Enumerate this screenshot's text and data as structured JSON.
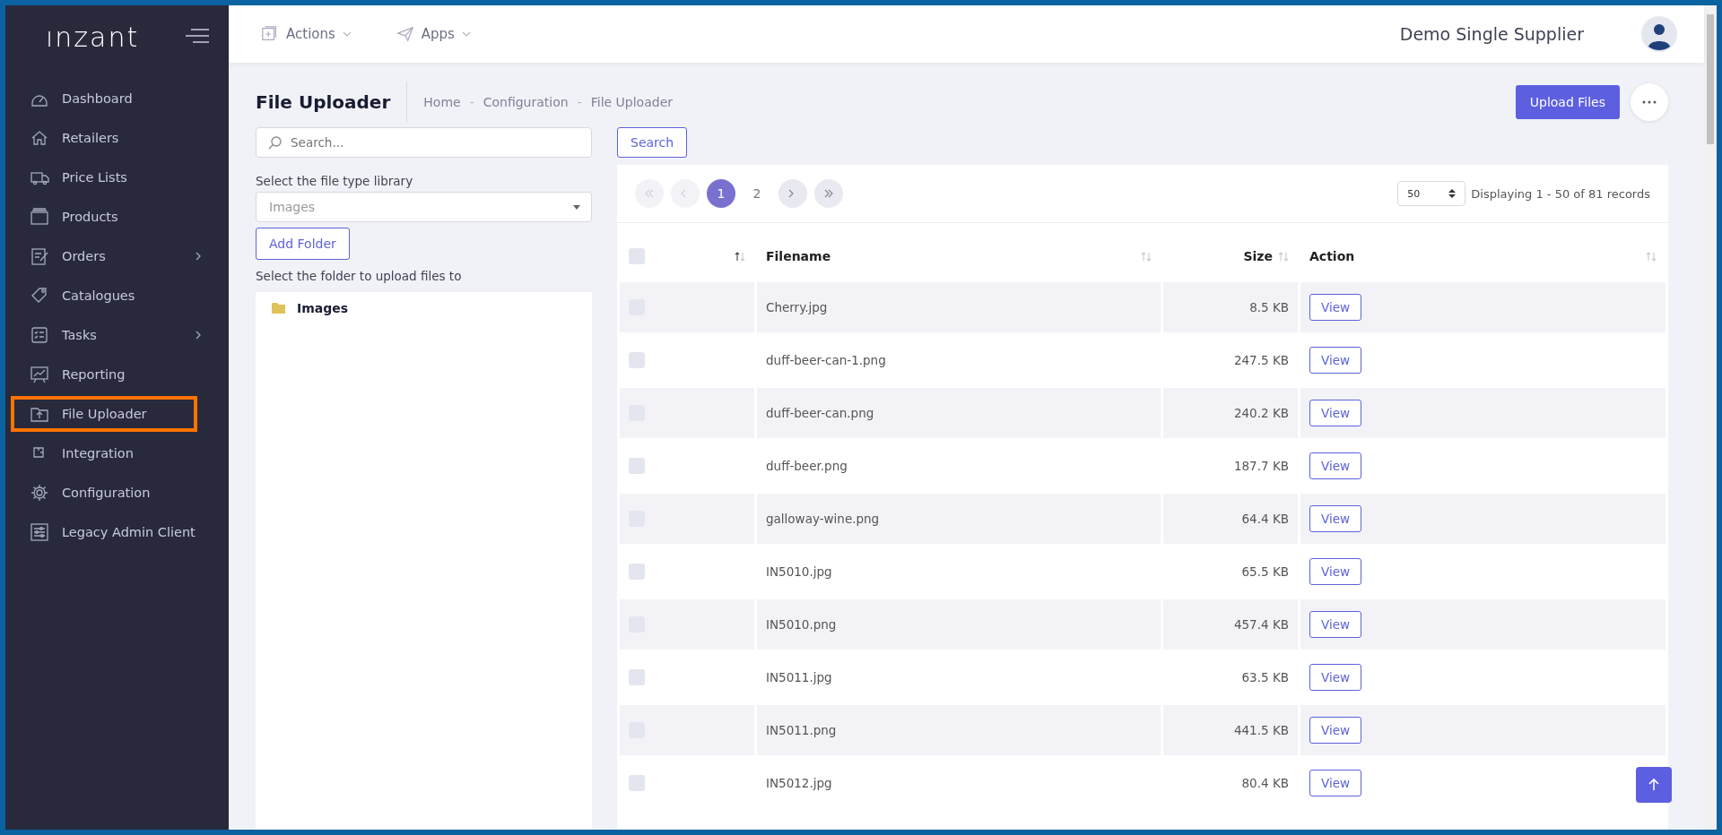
{
  "sidebar": {
    "logo": "ınzant",
    "items": [
      {
        "label": "Dashboard",
        "selected": false,
        "has_submenu": false
      },
      {
        "label": "Retailers",
        "selected": false,
        "has_submenu": false
      },
      {
        "label": "Price Lists",
        "selected": false,
        "has_submenu": false
      },
      {
        "label": "Products",
        "selected": false,
        "has_submenu": false
      },
      {
        "label": "Orders",
        "selected": false,
        "has_submenu": true
      },
      {
        "label": "Catalogues",
        "selected": false,
        "has_submenu": false
      },
      {
        "label": "Tasks",
        "selected": false,
        "has_submenu": true
      },
      {
        "label": "Reporting",
        "selected": false,
        "has_submenu": false
      },
      {
        "label": "File Uploader",
        "selected": true,
        "has_submenu": false
      },
      {
        "label": "Integration",
        "selected": false,
        "has_submenu": false
      },
      {
        "label": "Configuration",
        "selected": false,
        "has_submenu": false
      },
      {
        "label": "Legacy Admin Client",
        "selected": false,
        "has_submenu": false
      }
    ]
  },
  "topbar": {
    "menus": [
      {
        "label": "Actions"
      },
      {
        "label": "Apps"
      }
    ],
    "user": "Demo Single Supplier"
  },
  "page": {
    "title": "File Uploader",
    "breadcrumb": [
      {
        "kind": "link",
        "text": "Home"
      },
      {
        "kind": "separator",
        "text": "-"
      },
      {
        "kind": "link",
        "text": "Configuration"
      },
      {
        "kind": "separator",
        "text": "-"
      },
      {
        "kind": "link",
        "text": "File Uploader"
      }
    ],
    "upload_button": "Upload Files"
  },
  "left": {
    "search": {
      "placeholder": "Search..."
    },
    "library_label": "Select the file type library",
    "library_value": "Images",
    "add_folder": "Add Folder",
    "folder_label": "Select the folder to upload files to",
    "folders": [
      {
        "label": "Images"
      }
    ]
  },
  "search_button": "Search",
  "pagination": {
    "nav": [
      {
        "kind": "first",
        "disabled": true
      },
      {
        "kind": "prev",
        "disabled": true
      },
      {
        "kind": "pages"
      },
      {
        "kind": "next",
        "disabled": false
      },
      {
        "kind": "last",
        "disabled": false
      }
    ],
    "pages": [
      {
        "label": "1",
        "selected": true
      },
      {
        "label": "2",
        "selected": false
      }
    ],
    "page_size": "50",
    "summary": "Displaying 1 - 50 of 81 records"
  },
  "table": {
    "select_all_checked": false,
    "columns": [
      {
        "label": "Filename",
        "sorted": false
      },
      {
        "label": "Size",
        "sorted": false
      },
      {
        "label": "Action",
        "sorted": false
      }
    ],
    "first_column_sorted": true,
    "rows": [
      {
        "checked": false,
        "filename": "Cherry.jpg",
        "size": "8.5 KB",
        "action": "View"
      },
      {
        "checked": false,
        "filename": "duff-beer-can-1.png",
        "size": "247.5 KB",
        "action": "View"
      },
      {
        "checked": false,
        "filename": "duff-beer-can.png",
        "size": "240.2 KB",
        "action": "View"
      },
      {
        "checked": false,
        "filename": "duff-beer.png",
        "size": "187.7 KB",
        "action": "View"
      },
      {
        "checked": false,
        "filename": "galloway-wine.png",
        "size": "64.4 KB",
        "action": "View"
      },
      {
        "checked": false,
        "filename": "IN5010.jpg",
        "size": "65.5 KB",
        "action": "View"
      },
      {
        "checked": false,
        "filename": "IN5010.png",
        "size": "457.4 KB",
        "action": "View"
      },
      {
        "checked": false,
        "filename": "IN5011.jpg",
        "size": "63.5 KB",
        "action": "View"
      },
      {
        "checked": false,
        "filename": "IN5011.png",
        "size": "441.5 KB",
        "action": "View"
      },
      {
        "checked": false,
        "filename": "IN5012.jpg",
        "size": "80.4 KB",
        "action": "View"
      }
    ]
  }
}
